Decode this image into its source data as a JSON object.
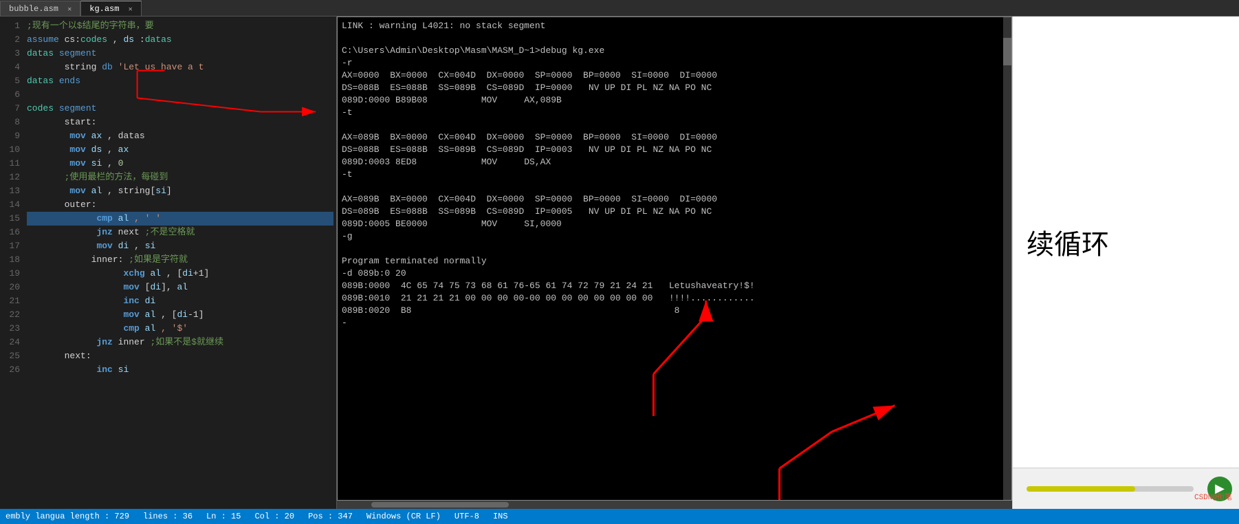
{
  "tabs": [
    {
      "label": "bubble.asm",
      "active": false,
      "closable": true
    },
    {
      "label": "kg.asm",
      "active": true,
      "closable": true
    }
  ],
  "editor": {
    "lines": [
      {
        "num": 1,
        "content": ";现有一个以$结尾的字符串，要...",
        "highlight": false,
        "parts": [
          {
            "type": "comment",
            "text": ";现有一个以$结尾的字符串，要"
          }
        ]
      },
      {
        "num": 2,
        "highlight": false
      },
      {
        "num": 3,
        "highlight": false
      },
      {
        "num": 4,
        "highlight": false
      },
      {
        "num": 5,
        "highlight": false
      },
      {
        "num": 6,
        "highlight": false
      },
      {
        "num": 7,
        "highlight": false
      },
      {
        "num": 8,
        "highlight": false
      },
      {
        "num": 9,
        "highlight": false
      },
      {
        "num": 10,
        "highlight": false
      },
      {
        "num": 11,
        "highlight": false
      },
      {
        "num": 12,
        "highlight": false
      },
      {
        "num": 13,
        "highlight": false
      },
      {
        "num": 14,
        "highlight": false
      },
      {
        "num": 15,
        "highlight": true
      },
      {
        "num": 16,
        "highlight": false
      },
      {
        "num": 17,
        "highlight": false
      },
      {
        "num": 18,
        "highlight": false
      },
      {
        "num": 19,
        "highlight": false
      },
      {
        "num": 20,
        "highlight": false
      },
      {
        "num": 21,
        "highlight": false
      },
      {
        "num": 22,
        "highlight": false
      },
      {
        "num": 23,
        "highlight": false
      },
      {
        "num": 24,
        "highlight": false
      },
      {
        "num": 25,
        "highlight": false
      },
      {
        "num": 26,
        "highlight": false
      }
    ]
  },
  "terminal": {
    "lines": [
      "LINK : warning L4021: no stack segment",
      "",
      "C:\\Users\\Admin\\Desktop\\Masm\\MASM_D~1>debug kg.exe",
      "-r",
      "AX=0000  BX=0000  CX=004D  DX=0000  SP=0000  BP=0000  SI=0000  DI=0000",
      "DS=088B  ES=088B  SS=089B  CS=089D  IP=0000   NV UP DI PL NZ NA PO NC",
      "089D:0000 B89B08          MOV     AX,089B",
      "-t",
      "",
      "AX=089B  BX=0000  CX=004D  DX=0000  SP=0000  BP=0000  SI=0000  DI=0000",
      "DS=088B  ES=088B  SS=089B  CS=089D  IP=0003   NV UP DI PL NZ NA PO NC",
      "089D:0003 8ED8            MOV     DS,AX",
      "-t",
      "",
      "AX=089B  BX=0000  CX=004D  DX=0000  SP=0000  BP=0000  SI=0000  DI=0000",
      "DS=089B  ES=088B  SS=089B  CS=089D  IP=0005   NV UP DI PL NZ NA PO NC",
      "089D:0005 BE0000          MOV     SI,0000",
      "-g",
      "",
      "Program terminated normally",
      "-d 089b:0 20",
      "089B:0000  4C 65 74 75 73 68 61 76-65 61 74 72 79 21 24 21   Letushaveatry!$!",
      "089B:0010  21 21 21 21 00 00 00 00-00 00 00 00 00 00 00 00   !!!!............",
      "089B:0020  B8                                                 8",
      "-"
    ]
  },
  "status_bar": {
    "assembly": "embly langua length : 729",
    "lines": "lines : 36",
    "ln": "Ln : 15",
    "col": "Col : 20",
    "pos": "Pos : 347",
    "encoding": "Windows (CR LF)",
    "charset": "UTF-8",
    "mode": "INS"
  },
  "right_panel": {
    "text": "续循环"
  },
  "progress": {
    "value": 65
  }
}
